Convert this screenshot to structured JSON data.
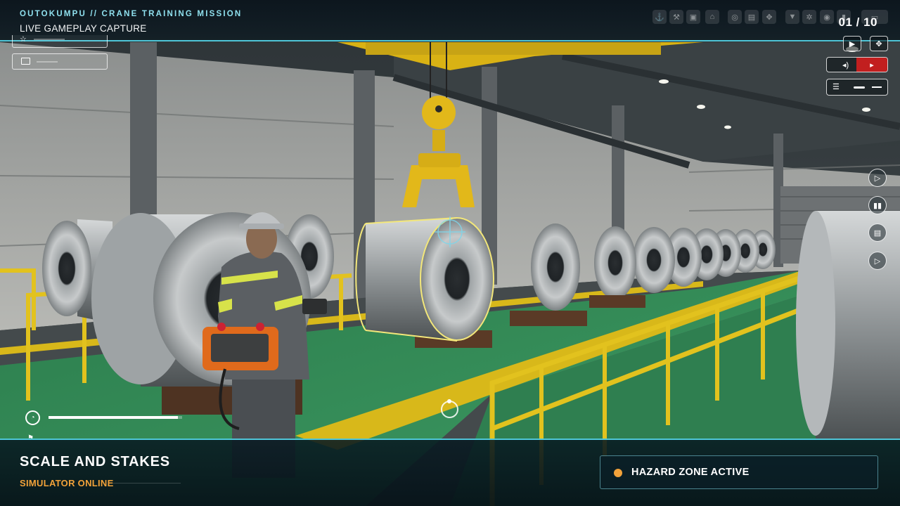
{
  "header": {
    "mission_label": "OUTOKUMPU // CRANE TRAINING MISSION",
    "capture_label": "LIVE GAMEPLAY CAPTURE",
    "counter": "01 / 10"
  },
  "footer": {
    "title": "SCALE AND STAKES",
    "subtitle": "SIMULATOR ONLINE",
    "status": "HAZARD ZONE ACTIVE"
  },
  "progress": {
    "value": 0.97
  },
  "colors": {
    "accent": "#4fc6d8",
    "warning": "#f2a23a",
    "safety_yellow": "#f0c419",
    "floor_green": "#2f8a57"
  },
  "icons": {
    "toolbar": [
      "hook-icon",
      "wrench-icon",
      "box-icon",
      "building-icon",
      "coil-icon",
      "book-icon",
      "gamepad-icon",
      "filter-icon",
      "settings-icon",
      "camera-icon",
      "battery-icon",
      "keyboard-icon"
    ],
    "side": [
      "play-icon",
      "audio-wave-icon",
      "document-icon",
      "next-icon"
    ]
  }
}
